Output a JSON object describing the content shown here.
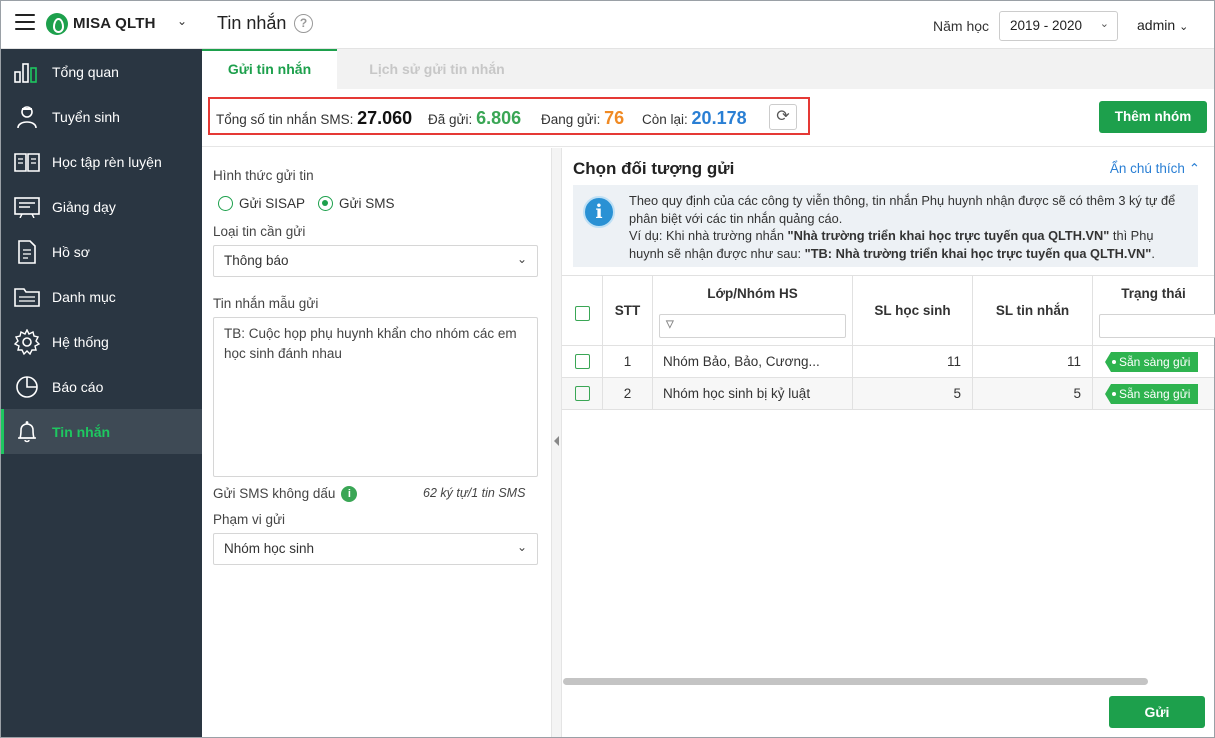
{
  "app": {
    "name": "MISA QLTH",
    "page_title": "Tin nhắn",
    "year_label": "Năm học",
    "year_value": "2019 - 2020",
    "user": "admin",
    "brand_color": "#1da04c"
  },
  "sidebar": {
    "items": [
      {
        "label": "Tổng quan",
        "icon": "dashboard-chart-icon"
      },
      {
        "label": "Tuyển sinh",
        "icon": "student-icon"
      },
      {
        "label": "Học tập rèn luyện",
        "icon": "book-icon"
      },
      {
        "label": "Giảng dạy",
        "icon": "blackboard-icon"
      },
      {
        "label": "Hồ sơ",
        "icon": "document-icon"
      },
      {
        "label": "Danh mục",
        "icon": "folder-icon"
      },
      {
        "label": "Hệ thống",
        "icon": "gear-icon"
      },
      {
        "label": "Báo cáo",
        "icon": "pie-chart-icon"
      },
      {
        "label": "Tin nhắn",
        "icon": "bell-icon",
        "active": true
      }
    ]
  },
  "tabs": [
    {
      "label": "Gửi tin nhắn",
      "active": true
    },
    {
      "label": "Lịch sử gửi tin nhắn",
      "active": false
    }
  ],
  "stats": {
    "total_label": "Tổng số tin nhắn SMS:",
    "total_value": "27.060",
    "sent_label": "Đã gửi:",
    "sent_value": "6.806",
    "sending_label": "Đang gửi:",
    "sending_value": "76",
    "remaining_label": "Còn lại:",
    "remaining_value": "20.178"
  },
  "add_group_label": "Thêm nhóm",
  "form": {
    "send_method_label": "Hình thức gửi tin",
    "radio_sisap": "Gửi SISAP",
    "radio_sms": "Gửi SMS",
    "message_type_label": "Loại tin cần gửi",
    "message_type_value": "Thông báo",
    "template_label": "Tin nhắn mẫu gửi",
    "template_text": "TB: Cuộc họp phụ huynh khẩn cho nhóm các em học sinh đánh nhau",
    "no_accent_label": "Gửi SMS không dấu",
    "char_count": "62 ký tự/1 tin SMS",
    "scope_label": "Phạm vi gửi",
    "scope_value": "Nhóm học sinh"
  },
  "recipients": {
    "title": "Chọn đối tượng gửi",
    "hide_note": "Ẩn chú thích",
    "notice_line1": "Theo quy định của các công ty viễn thông, tin nhắn Phụ huynh nhận được sẽ có thêm 3 ký tự để phân biệt với các tin nhắn quảng cáo.",
    "notice_ex_prefix": "Ví dụ: Khi nhà trường nhắn ",
    "notice_ex_msg": "\"Nhà trường triển khai học trực tuyến qua QLTH.VN\"",
    "notice_ex_mid": " thì Phụ huynh sẽ nhận được như sau: ",
    "notice_ex_recv": "\"TB: Nhà trường triển khai học trực tuyến qua QLTH.VN\"",
    "notice_ex_end": ".",
    "columns": {
      "stt": "STT",
      "class_group": "Lớp/Nhóm HS",
      "students": "SL học sinh",
      "messages": "SL tin nhắn",
      "status": "Trạng thái"
    },
    "rows": [
      {
        "stt": "1",
        "name": "Nhóm Bảo, Bảo, Cương...",
        "students": "11",
        "messages": "11",
        "status": "Sẵn sàng gửi"
      },
      {
        "stt": "2",
        "name": "Nhóm học sinh bị kỷ luật",
        "students": "5",
        "messages": "5",
        "status": "Sẵn sàng gửi"
      }
    ]
  },
  "send_label": "Gửi"
}
